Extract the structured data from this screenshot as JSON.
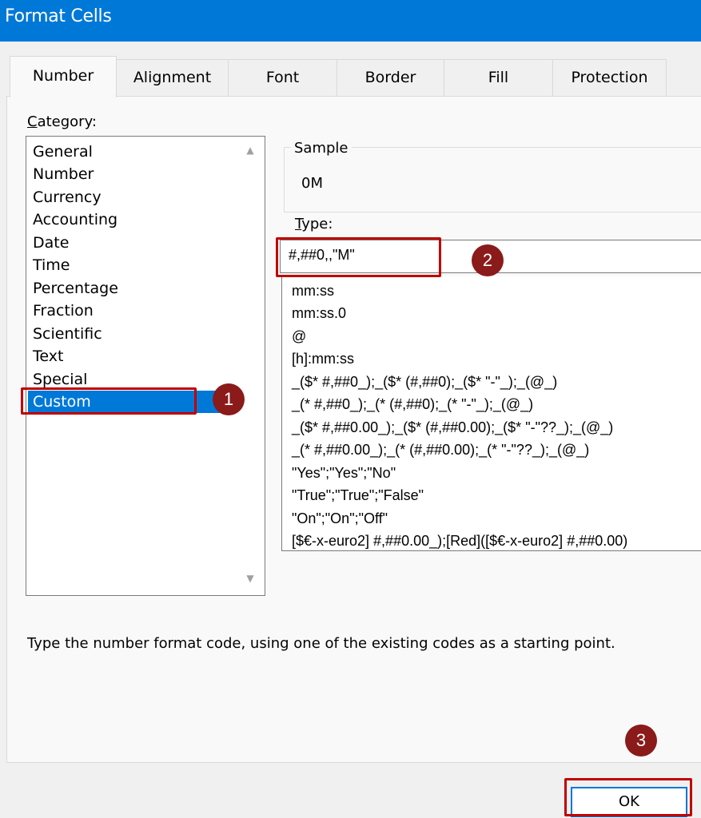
{
  "window": {
    "title": "Format Cells"
  },
  "tabs": [
    {
      "label": "Number",
      "active": true
    },
    {
      "label": "Alignment"
    },
    {
      "label": "Font"
    },
    {
      "label": "Border"
    },
    {
      "label": "Fill"
    },
    {
      "label": "Protection"
    }
  ],
  "category": {
    "label_first": "C",
    "label_rest": "ategory:",
    "items": [
      "General",
      "Number",
      "Currency",
      "Accounting",
      "Date",
      "Time",
      "Percentage",
      "Fraction",
      "Scientific",
      "Text",
      "Special",
      "Custom"
    ],
    "selected": "Custom"
  },
  "sample": {
    "label": "Sample",
    "value": "0M"
  },
  "type": {
    "label_first": "T",
    "label_rest": "ype:",
    "value": "#,##0,,\"M\"",
    "options": [
      "mm:ss",
      "mm:ss.0",
      "@",
      "[h]:mm:ss",
      "_($* #,##0_);_($* (#,##0);_($* \"-\"_);_(@_)",
      "_(* #,##0_);_(* (#,##0);_(* \"-\"_);_(@_)",
      "_($* #,##0.00_);_($* (#,##0.00);_($* \"-\"??_);_(@_)",
      "_(* #,##0.00_);_(* (#,##0.00);_(* \"-\"??_);_(@_)",
      "\"Yes\";\"Yes\";\"No\"",
      "\"True\";\"True\";\"False\"",
      "\"On\";\"On\";\"Off\"",
      "[$€-x-euro2] #,##0.00_);[Red]([$€-x-euro2] #,##0.00)"
    ]
  },
  "hint": "Type the number format code, using one of the existing codes as a starting point.",
  "buttons": {
    "ok": "OK"
  },
  "callouts": [
    "1",
    "2",
    "3"
  ],
  "colors": {
    "accent": "#0078d7",
    "callout": "#c00000",
    "badge": "#8b1a1a"
  }
}
